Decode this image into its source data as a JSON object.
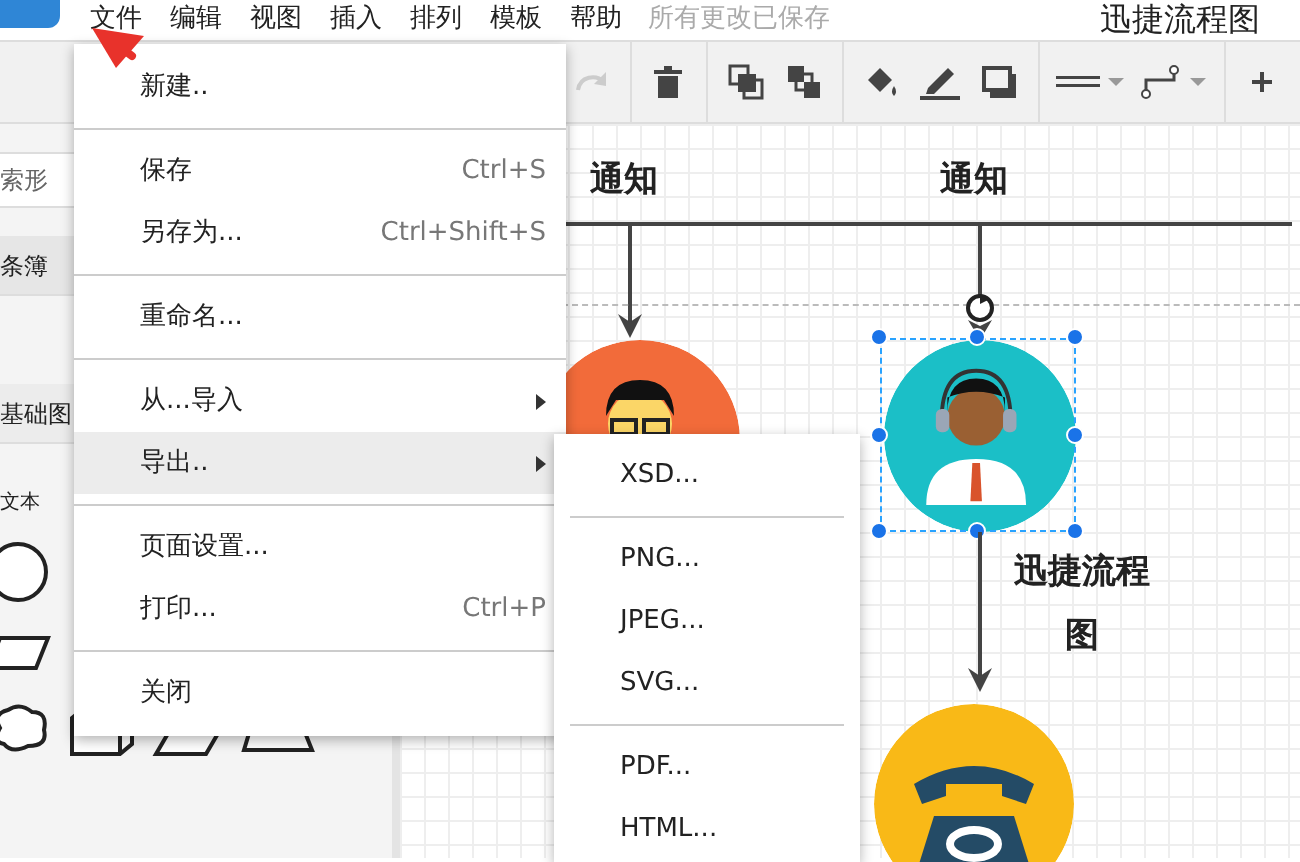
{
  "menubar": {
    "items": [
      "文件",
      "编辑",
      "视图",
      "插入",
      "排列",
      "模板",
      "帮助"
    ],
    "save_status": "所有更改已保存",
    "title": "迅捷流程图"
  },
  "toolbar": [
    {
      "kind": "redo",
      "disabled": true
    },
    {
      "kind": "delete",
      "disabled": false
    },
    {
      "kind": "to-front",
      "disabled": false
    },
    {
      "kind": "to-back",
      "disabled": false
    },
    {
      "kind": "fill",
      "disabled": false
    },
    {
      "kind": "line-color",
      "disabled": false
    },
    {
      "kind": "shadow",
      "disabled": false
    },
    {
      "kind": "line-style",
      "disabled": false
    },
    {
      "kind": "connector",
      "disabled": false
    },
    {
      "kind": "add",
      "disabled": false
    }
  ],
  "sidebar": {
    "search": {
      "placeholder": "索形"
    },
    "sections": [
      "条簿",
      "基础图"
    ],
    "text_label": "文本"
  },
  "file_menu": {
    "items": [
      {
        "kind": "item",
        "label": "新建..",
        "selected": false
      },
      {
        "kind": "divider"
      },
      {
        "kind": "item",
        "label": "保存",
        "shortcut": "Ctrl+S",
        "selected": false
      },
      {
        "kind": "item",
        "label": "另存为...",
        "shortcut": "Ctrl+Shift+S",
        "selected": false
      },
      {
        "kind": "divider"
      },
      {
        "kind": "item",
        "label": "重命名...",
        "selected": false
      },
      {
        "kind": "divider"
      },
      {
        "kind": "submenu",
        "label": "从...导入",
        "selected": false
      },
      {
        "kind": "submenu",
        "label": "导出..",
        "selected": true
      },
      {
        "kind": "divider"
      },
      {
        "kind": "item",
        "label": "页面设置...",
        "selected": false
      },
      {
        "kind": "item",
        "label": "打印...",
        "shortcut": "Ctrl+P",
        "selected": false
      },
      {
        "kind": "divider"
      },
      {
        "kind": "item",
        "label": "关闭",
        "selected": false
      }
    ]
  },
  "export_menu": {
    "items": [
      {
        "kind": "item",
        "label": "XSD..."
      },
      {
        "kind": "divider"
      },
      {
        "kind": "item",
        "label": "PNG..."
      },
      {
        "kind": "item",
        "label": "JPEG..."
      },
      {
        "kind": "item",
        "label": "SVG..."
      },
      {
        "kind": "divider"
      },
      {
        "kind": "item",
        "label": "PDF..."
      },
      {
        "kind": "item",
        "label": "HTML..."
      }
    ]
  },
  "canvas": {
    "headers": [
      "通知",
      "通知"
    ],
    "nodes": [
      {
        "kind": "person",
        "color": "#f26b3a",
        "selected": false
      },
      {
        "kind": "agent",
        "color": "#1bbfc7",
        "selected": true,
        "label": "迅捷流程图"
      },
      {
        "kind": "phone",
        "color": "#f9b917",
        "selected": false
      }
    ]
  }
}
